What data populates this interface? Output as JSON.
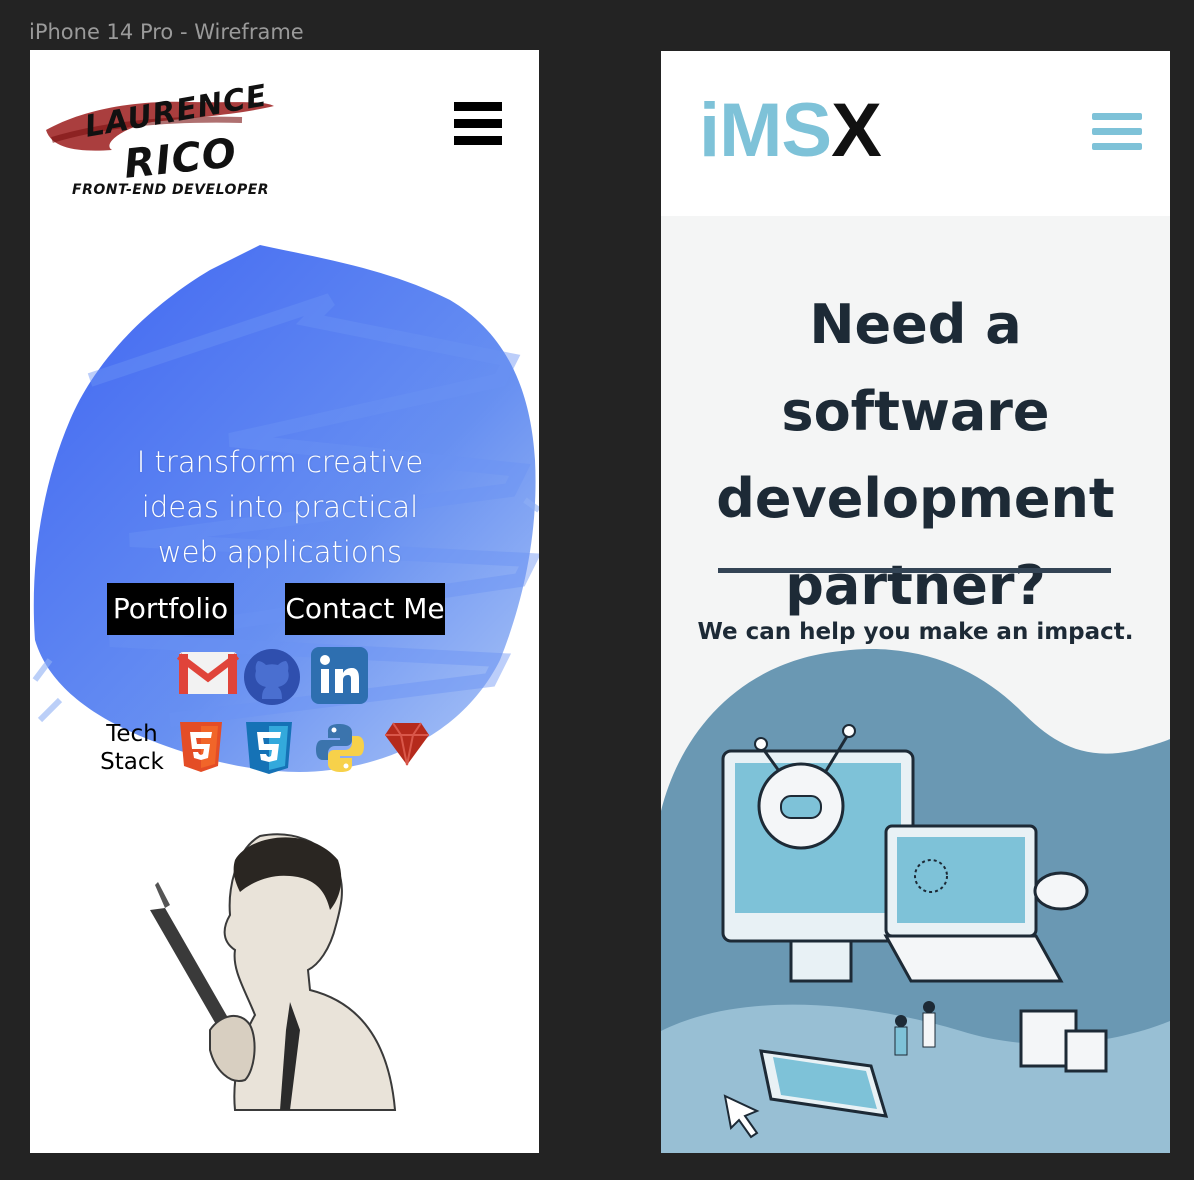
{
  "frame_label": "iPhone 14 Pro - Wireframe",
  "left": {
    "logo": {
      "first": "LAURENCE",
      "last": "RICO",
      "subtitle": "FRONT-END DEVELOPER"
    },
    "menu_icon": "hamburger-icon",
    "tagline": "I transform creative ideas into practical web applications",
    "buttons": {
      "portfolio": "Portfolio",
      "contact": "Contact Me"
    },
    "social_icons": [
      "gmail-icon",
      "github-icon",
      "linkedin-icon"
    ],
    "tech_stack": {
      "label_line1": "Tech",
      "label_line2": "Stack",
      "icons": [
        "html5-icon",
        "css3-icon",
        "python-icon",
        "ruby-icon"
      ]
    },
    "colors": {
      "brush": "#3d68f0",
      "logo_stroke": "#9b1c1c"
    }
  },
  "right": {
    "logo": {
      "i": "i",
      "ms": "MS",
      "x": "X"
    },
    "menu_icon": "hamburger-icon",
    "hero": {
      "title": "Need a software development partner?",
      "subtitle": "We can help you make an impact."
    },
    "colors": {
      "accent": "#7ec2d8",
      "text": "#1d2a36",
      "cloud": "#6a98b3"
    }
  }
}
